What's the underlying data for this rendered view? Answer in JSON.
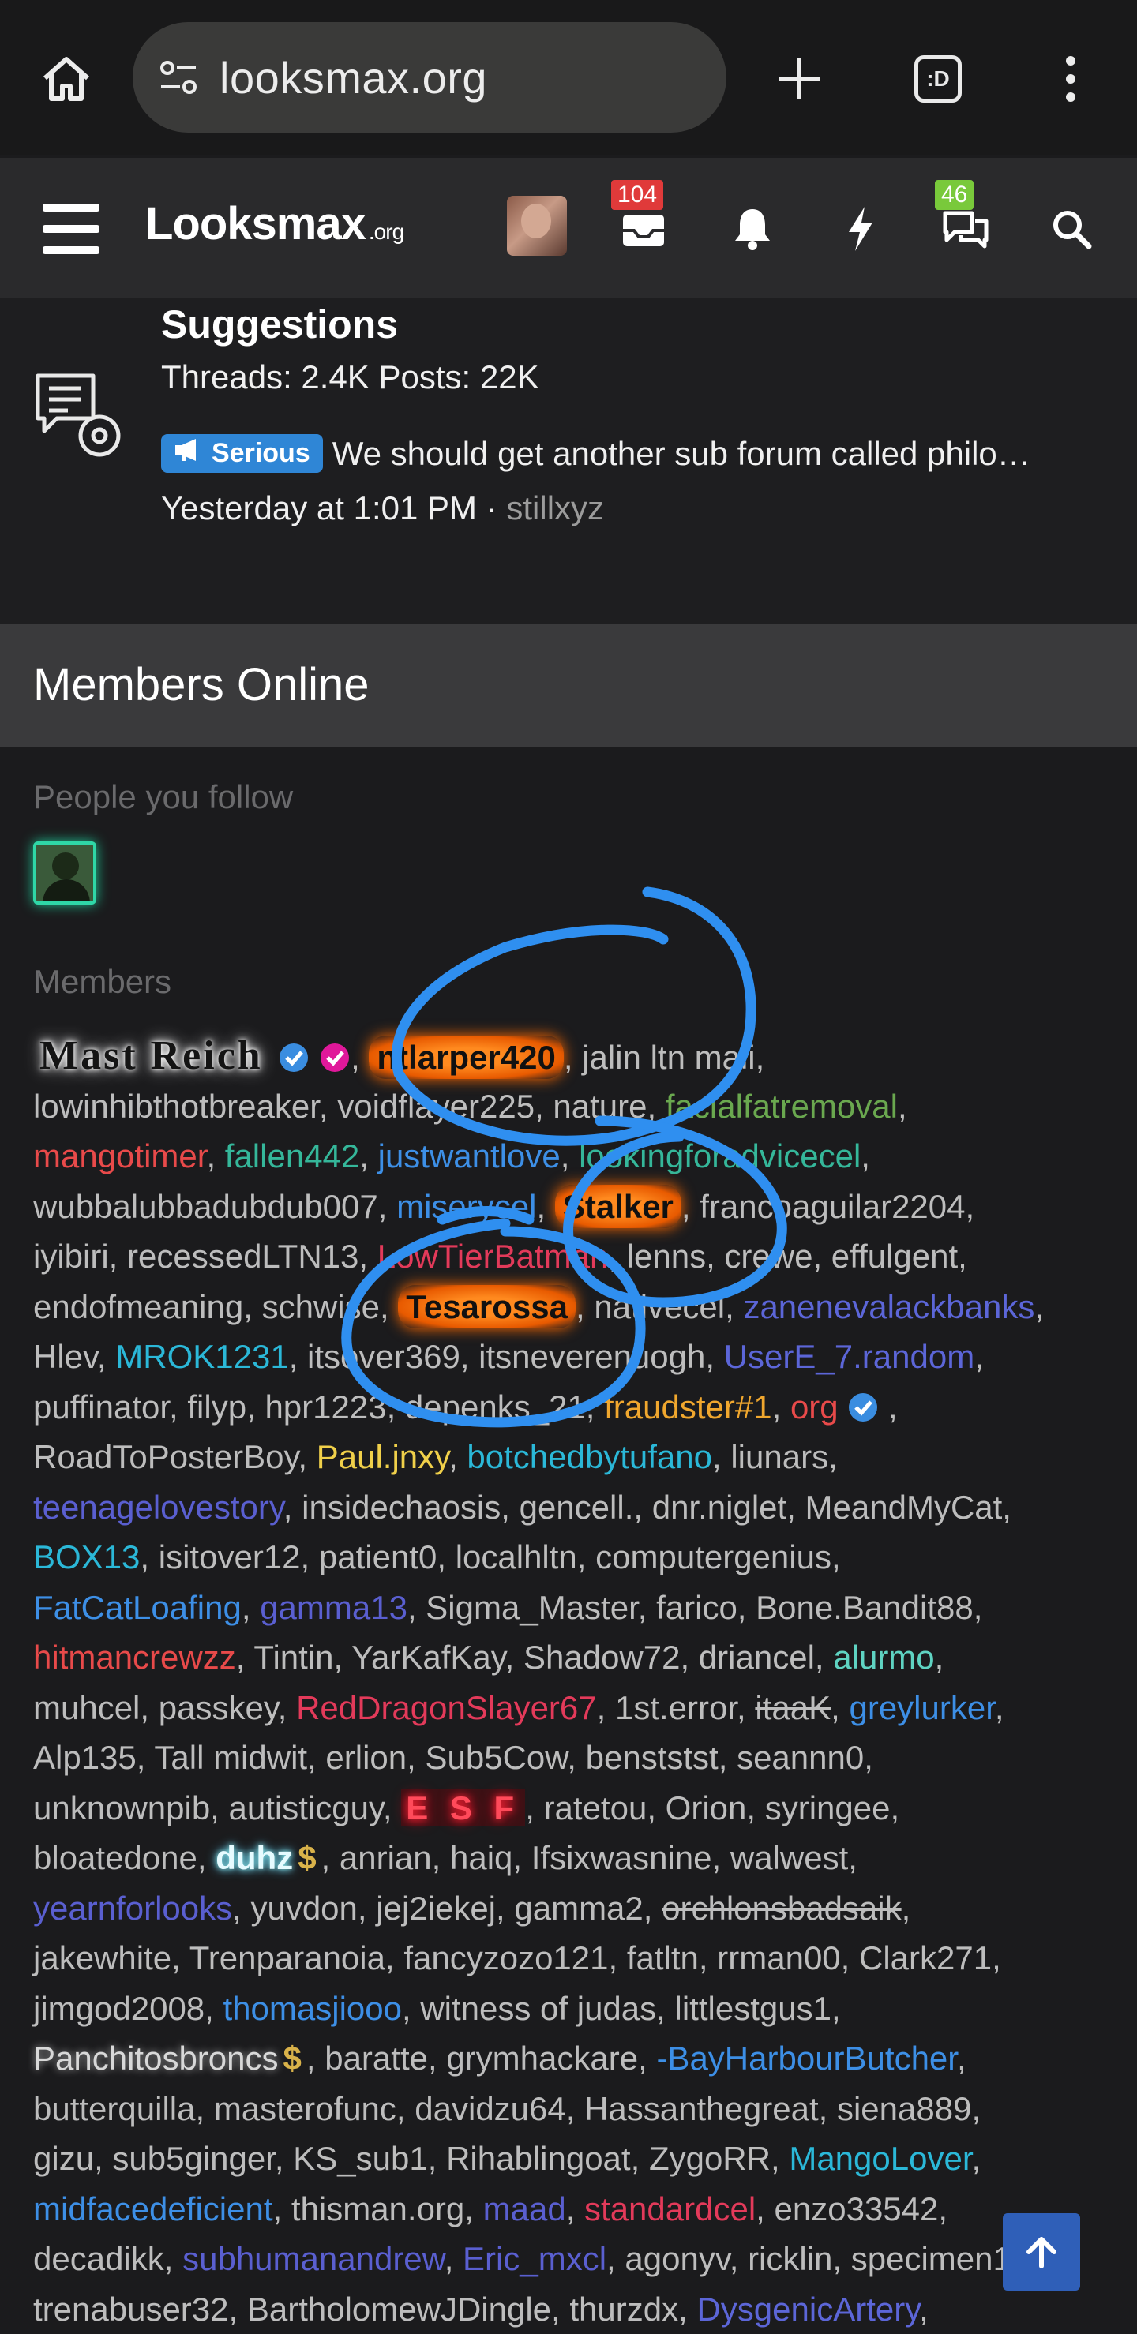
{
  "browser": {
    "url": "looksmax.org",
    "tabs_count": ":D",
    "icons": [
      "home-icon",
      "tune-icon",
      "plus-icon",
      "tabs-icon",
      "more-vert-icon"
    ]
  },
  "header": {
    "logo_main": "Looksmax",
    "logo_suffix": ".org",
    "inbox_badge": "104",
    "conversations_badge": "46",
    "icons": [
      "menu-icon",
      "avatar",
      "inbox-icon",
      "bell-icon",
      "bolt-icon",
      "chat-icon",
      "search-icon"
    ]
  },
  "forum_node": {
    "title": "Suggestions",
    "stats": "Threads: 2.4K Posts: 22K",
    "prefix": "Serious",
    "latest_thread": "We should get another sub forum called philo…",
    "latest_time": "Yesterday at 1:01 PM",
    "separator": " · ",
    "latest_user": "stillxyz"
  },
  "members_online": {
    "heading": "Members Online",
    "following_label": "People you follow",
    "members_label": "Members",
    "names": {
      "n1": "Mast Reich",
      "n2": "ntlarper420",
      "n3": "jalin ltn mali",
      "n4": "lowinhibthotbreaker",
      "n5": "voidflayer225",
      "n6": "nature",
      "n7": "facialfatremoval",
      "n8": "mangotimer",
      "n9": "fallen442",
      "n10": "justwantlove",
      "n11": "lookingforadvicecel",
      "n12": "wubbalubbadubdub007",
      "n13": "miserycel",
      "n14": "Stalker",
      "n15": "francoaguilar2204",
      "n16": "iyibiri",
      "n17": "recessedLTN13",
      "n18": "LowTierBatman",
      "n19": "lenns",
      "n20": "crewe",
      "n21": "effulgent",
      "n22": "endofmeaning",
      "n23": "schwise",
      "n24": "Tesarossa",
      "n25": "nativecel",
      "n26": "zanenevalackbanks",
      "n27": "Hlev",
      "n28": "MROK1231",
      "n29": "itsover369",
      "n30": "itsneverenuogh",
      "n31": "UserE_7.random",
      "n32": "puffinator",
      "n33": "filyp",
      "n34": "hpr1223",
      "n35": "depenks_21",
      "n36": "fraudster#1",
      "n37": "org",
      "n38": "RoadToPosterBoy",
      "n39": "Paul.jnxy",
      "n40": "botchedbytufano",
      "n41": "liunars",
      "n42": "teenagelovestory",
      "n43": "insidechaosis",
      "n44": "gencell.",
      "n45": "dnr.niglet",
      "n46": "MeandMyCat",
      "n47": "BOX13",
      "n48": "isitover12",
      "n49": "patient0",
      "n50": "localhltn",
      "n51": "computergenius",
      "n52": "FatCatLoafing",
      "n53": "gamma13",
      "n54": "Sigma_Master",
      "n55": "farico",
      "n56": "Bone.Bandit88",
      "n57": "hitmancrewzz",
      "n58": "Tintin",
      "n59": "YarKafKay",
      "n60": "Shadow72",
      "n61": "driancel",
      "n62": "alurmo",
      "n63": "muhcel",
      "n64": "passkey",
      "n65": "RedDragonSlayer67",
      "n66": "1st.error",
      "n67": "itaaK",
      "n68": "greylurker",
      "n69": "Alp135",
      "n70": "Tall midwit",
      "n71": "erlion",
      "n72": "Sub5Cow",
      "n73": "benststst",
      "n74": "seannn0",
      "n75": "unknownpib",
      "n76": "autisticguy",
      "n77": "E S F",
      "n78": "ratetou",
      "n79": "Orion",
      "n80": "syringee",
      "n81": "bloatedone",
      "n82": "duhz",
      "n83": "anrian",
      "n84": "haiq",
      "n85": "Ifsixwasnine",
      "n86": "walwest",
      "n87": "yearnforlooks",
      "n88": "yuvdon",
      "n89": "jej2iekej",
      "n90": "gamma2",
      "n91": "orchlonsbadsaik",
      "n92": "jakewhite",
      "n93": "Trenparanoia",
      "n94": "fancyzozo121",
      "n95": "fatltn",
      "n96": "rrman00",
      "n97": "Clark271",
      "n98": "jimgod2008",
      "n99": "thomasjiooo",
      "n100": "witness of judas",
      "n101": "littlestgus1",
      "n102": "Panchitosbroncs",
      "n103": "baratte",
      "n104": "grymhackare",
      "n105": "-BayHarbourButcher",
      "n106": "butterquilla",
      "n107": "masterofunc",
      "n108": "davidzu64",
      "n109": "Hassanthegreat",
      "n110": "siena889",
      "n111": "gizu",
      "n112": "sub5ginger",
      "n113": "KS_sub1",
      "n114": "Rihablingoat",
      "n115": "ZygoRR",
      "n116": "MangoLover",
      "n117": "midfacedeficient",
      "n118": "thisman.org",
      "n119": "maad",
      "n120": "standardcel",
      "n121": "enzo33542",
      "n122": "decadikk",
      "n123": "subhumanandrew",
      "n124": "Eric_mxcl",
      "n125": "agonyv",
      "n126": "ricklin",
      "n127": "specimen1",
      "n128": "trenabuser32",
      "n129": "BartholomewJDingle",
      "n130": "thurzdx",
      "n131": "DysgenicArtery"
    },
    "dollar_glyph": "$"
  },
  "colors": {
    "accent_blue": "#2f86d6",
    "badge_red": "#e03a3a",
    "badge_green": "#79c93b",
    "annotation_blue": "#2f8ff0"
  }
}
